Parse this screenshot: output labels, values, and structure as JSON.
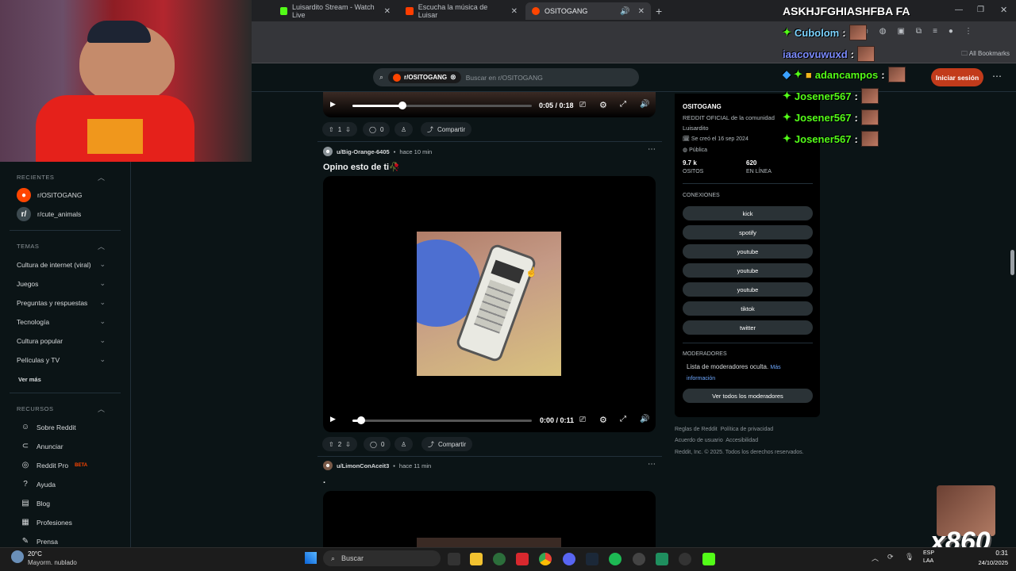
{
  "browser": {
    "tabs": [
      {
        "label": "Luisardito Stream - Watch Live",
        "color": "#53fc18"
      },
      {
        "label": "Escucha la música de Luisar",
        "color": "#ff3d00"
      },
      {
        "label": "OSITOGANG",
        "color": "#ff4500"
      }
    ],
    "new_tab": "+",
    "all_bookmarks": "All Bookmarks"
  },
  "header": {
    "search_chip": "r/OSITOGANG",
    "search_placeholder": "Buscar en r/OSITOGANG",
    "login_label": "Iniciar sesión",
    "more": "⋯"
  },
  "left_sidebar": {
    "recientes_title": "RECIENTES",
    "recent": [
      {
        "label": "r/OSITOGANG"
      },
      {
        "label": "r/cute_animals"
      }
    ],
    "temas_title": "TEMAS",
    "topics": [
      "Cultura de internet (viral)",
      "Juegos",
      "Preguntas y respuestas",
      "Tecnología",
      "Cultura popular",
      "Películas y TV"
    ],
    "ver_mas": "Ver más",
    "recursos_title": "RECURSOS",
    "resources": [
      {
        "label": "Sobre Reddit",
        "icon": "reddit-icon"
      },
      {
        "label": "Anunciar",
        "icon": "megaphone-icon"
      },
      {
        "label": "Reddit Pro",
        "icon": "pro-icon",
        "badge": "BETA"
      },
      {
        "label": "Ayuda",
        "icon": "help-icon"
      },
      {
        "label": "Blog",
        "icon": "book-icon"
      },
      {
        "label": "Profesiones",
        "icon": "briefcase-icon"
      },
      {
        "label": "Prensa",
        "icon": "mic-icon"
      }
    ]
  },
  "posts": [
    {
      "votes": "1",
      "comments": "0",
      "share": "Compartir",
      "time": "0:05 / 0:18",
      "progress": 0.28
    },
    {
      "user": "u/Big-Orange-6405",
      "age": "hace 10 min",
      "title": "Opino esto de ti🥀",
      "time": "0:00 / 0:11",
      "progress": 0.05,
      "votes": "2",
      "comments": "0",
      "share": "Compartir"
    },
    {
      "user": "u/LimonConAceit3",
      "age": "hace 11 min",
      "title": "."
    }
  ],
  "community": {
    "name": "OSITOGANG",
    "description": "REDDIT OFICIAL de la comunidad Luisardito",
    "created": "Se creó el 16 sep 2024",
    "visibility": "Pública",
    "members_count": "9.7 k",
    "members_label": "OSITOS",
    "online_count": "620",
    "online_label": "EN LÍNEA",
    "connections_title": "CONEXIONES",
    "connections": [
      "kick",
      "spotify",
      "youtube",
      "youtube",
      "youtube",
      "tiktok",
      "twitter"
    ],
    "moderators_title": "MODERADORES",
    "moderators_text": "Lista de moderadores oculta.",
    "moderators_link": "Más información",
    "moderators_button": "Ver todos los moderadores"
  },
  "footer": {
    "line1a": "Reglas de Reddit",
    "line1b": "Política de privacidad",
    "line2a": "Acuerdo de usuario",
    "line2b": "Accesibilidad",
    "line3": "Reddit, Inc. © 2025. Todos los derechos reservados."
  },
  "stream_overlay": {
    "title": "ASKHJFGHIASHFBA FA",
    "messages": [
      {
        "user": "Cubolom",
        "color": "#7cd4ff"
      },
      {
        "user": "iaacovuwuxd",
        "color": "#7c8cff"
      },
      {
        "user": "adancampos",
        "color": "#53fc18"
      },
      {
        "user": "Josener567",
        "color": "#53fc18"
      },
      {
        "user": "Josener567",
        "color": "#53fc18"
      },
      {
        "user": "Josener567",
        "color": "#53fc18"
      }
    ],
    "combo": "x860"
  },
  "taskbar": {
    "weather_temp": "20°C",
    "weather_desc": "Mayorm. nublado",
    "search": "Buscar",
    "lang": "ESP\nLAA",
    "time": "0:31",
    "date": "24/10/2025"
  }
}
